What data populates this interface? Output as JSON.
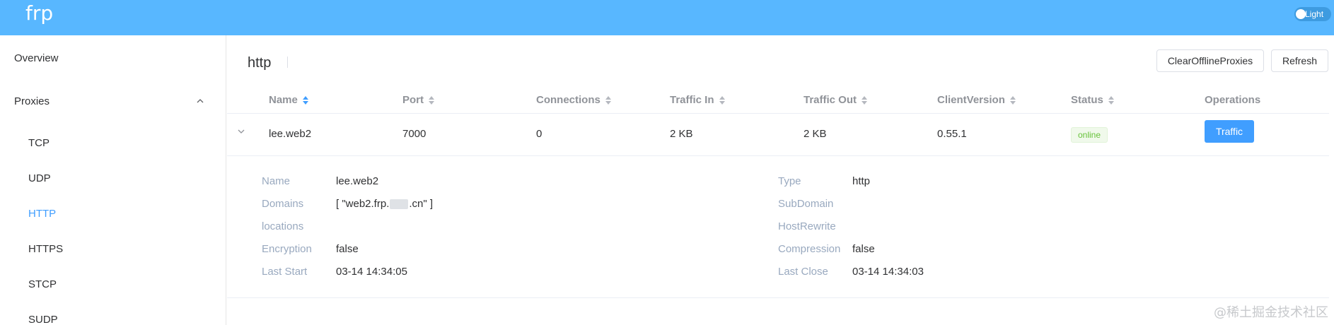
{
  "header": {
    "app_title": "frp",
    "theme_toggle_label": "Light"
  },
  "sidebar": {
    "overview": "Overview",
    "proxies": "Proxies",
    "items": [
      "TCP",
      "UDP",
      "HTTP",
      "HTTPS",
      "STCP",
      "SUDP"
    ],
    "active_item": "HTTP"
  },
  "main": {
    "title": "http",
    "buttons": {
      "clear_offline": "ClearOfflineProxies",
      "refresh": "Refresh"
    },
    "table": {
      "columns": [
        "Name",
        "Port",
        "Connections",
        "Traffic In",
        "Traffic Out",
        "ClientVersion",
        "Status",
        "Operations"
      ],
      "sorted_column": "Name",
      "row": {
        "name": "lee.web2",
        "port": "7000",
        "connections": "0",
        "traffic_in": "2 KB",
        "traffic_out": "2 KB",
        "client_version": "0.55.1",
        "status": "online",
        "operation_label": "Traffic"
      }
    },
    "details": {
      "left": [
        {
          "label": "Name",
          "value": "lee.web2"
        },
        {
          "label": "Domains",
          "value_prefix": "[ \"web2.frp.",
          "value_suffix": ".cn\" ]"
        },
        {
          "label": "locations",
          "value": ""
        },
        {
          "label": "Encryption",
          "value": "false"
        },
        {
          "label": "Last Start",
          "value": "03-14 14:34:05"
        }
      ],
      "right": [
        {
          "label": "Type",
          "value": "http"
        },
        {
          "label": "SubDomain",
          "value": ""
        },
        {
          "label": "HostRewrite",
          "value": ""
        },
        {
          "label": "Compression",
          "value": "false"
        },
        {
          "label": "Last Close",
          "value": "03-14 14:34:03"
        }
      ]
    }
  },
  "watermark": "@稀土掘金技术社区",
  "colors": {
    "header_bg": "#58b7ff",
    "accent": "#409eff",
    "online_green": "#67c23a"
  }
}
